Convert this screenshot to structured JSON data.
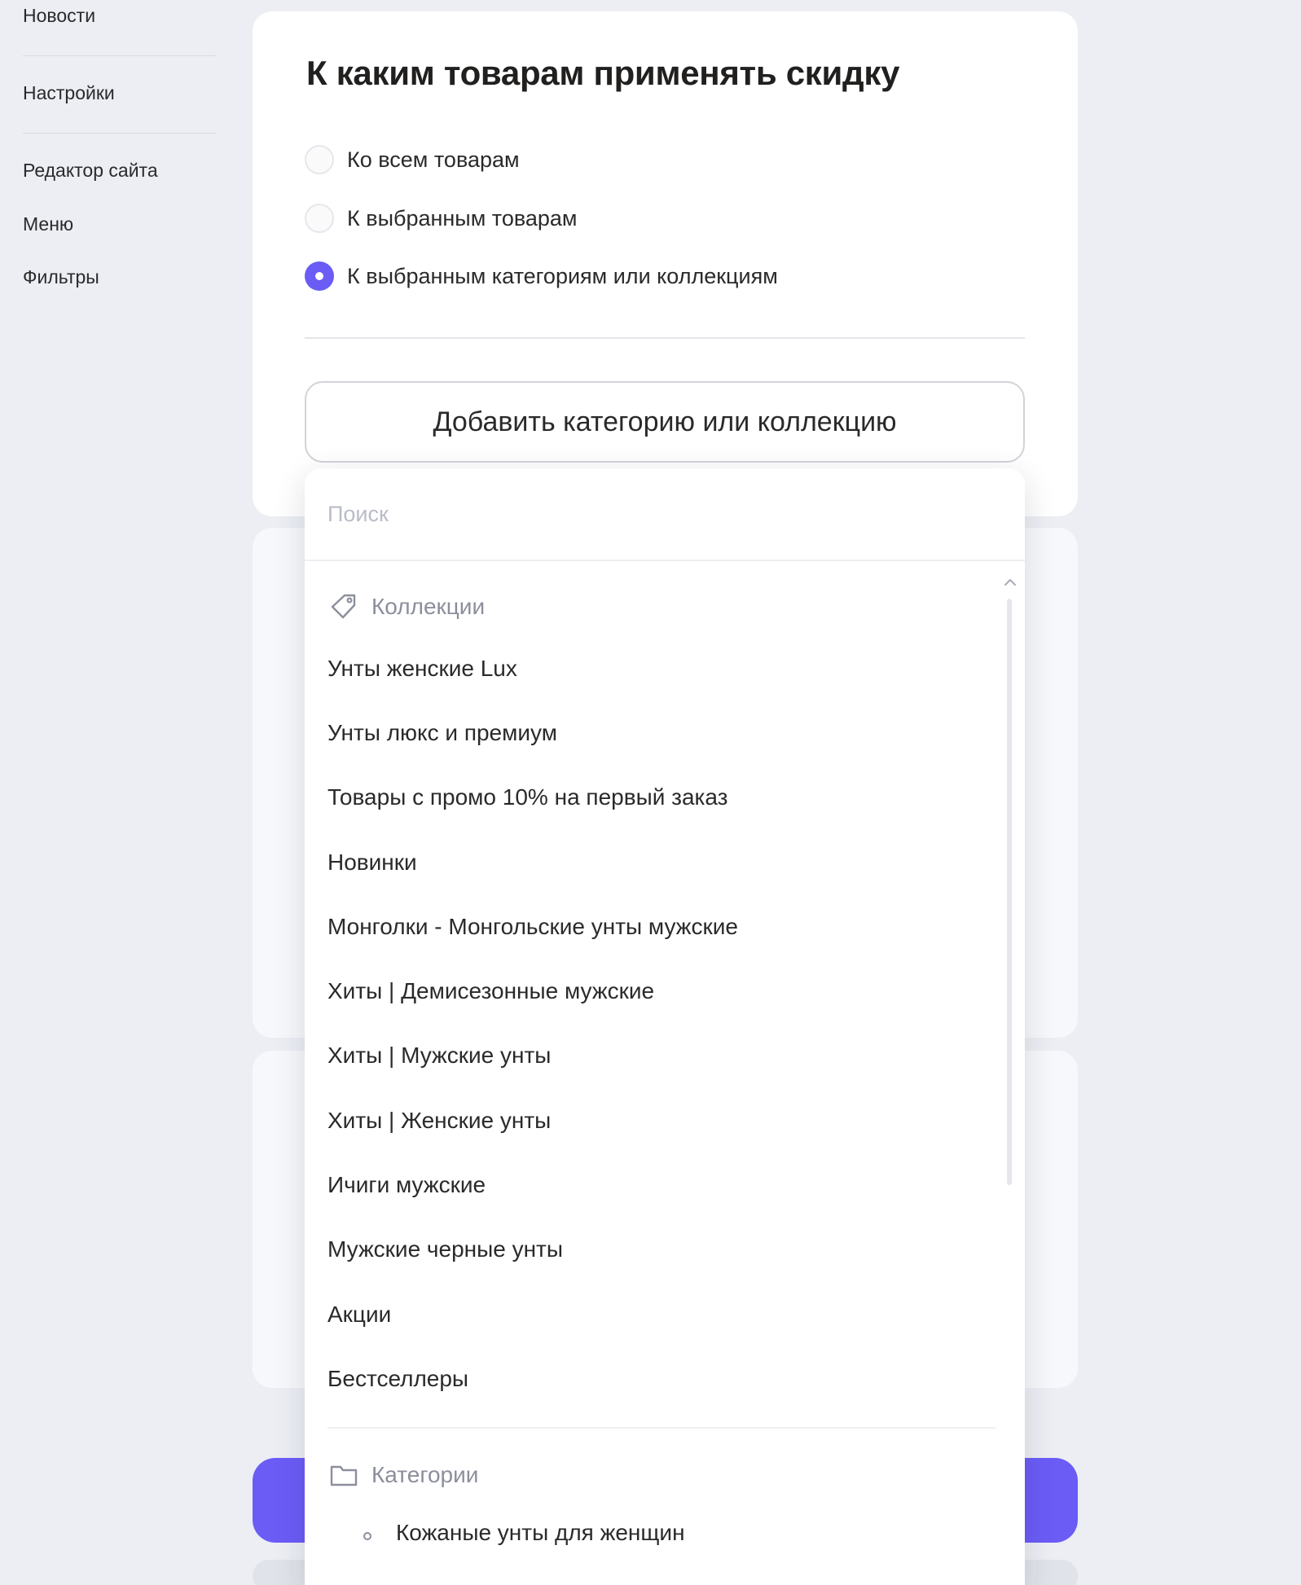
{
  "sidebar": {
    "items": [
      {
        "label": "Новости"
      },
      {
        "label": "Настройки"
      },
      {
        "label": "Редактор сайта"
      },
      {
        "label": "Меню"
      },
      {
        "label": "Фильтры"
      }
    ]
  },
  "discount_scope": {
    "title": "К каким товарам применять скидку",
    "options": [
      {
        "label": "Ко всем товарам",
        "checked": false
      },
      {
        "label": "К выбранным товарам",
        "checked": false
      },
      {
        "label": "К выбранным категориям или коллекциям",
        "checked": true
      }
    ],
    "add_button_label": "Добавить категорию или коллекцию"
  },
  "dropdown": {
    "search_placeholder": "Поиск",
    "collections": {
      "label": "Коллекции",
      "icon": "tag-icon",
      "items": [
        "Унты женские Lux",
        "Унты люкс и премиум",
        "Товары с промо 10% на первый заказ",
        "Новинки",
        "Монголки - Монгольские унты мужские",
        "Хиты | Демисезонные мужские",
        "Хиты | Мужские унты",
        "Хиты | Женские унты",
        "Ичиги мужские",
        "Мужские черные унты",
        "Акции",
        "Бестселлеры"
      ]
    },
    "categories": {
      "label": "Категории",
      "icon": "folder-icon",
      "items": [
        "Кожаные унты для женщин"
      ]
    }
  },
  "colors": {
    "accent": "#6b5cf6",
    "background": "#eceef4",
    "card": "#ffffff",
    "muted_text": "#8b8f9c"
  }
}
